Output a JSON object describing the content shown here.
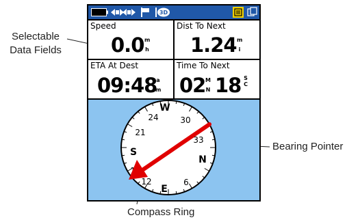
{
  "callouts": {
    "data_fields_line1": "Selectable",
    "data_fields_line2": "Data Fields",
    "bearing_pointer": "Bearing Pointer",
    "compass_ring": "Compass Ring"
  },
  "status_bar": {
    "icons": [
      "battery-icon",
      "signal-icon",
      "flag-icon",
      "3d-fix-icon",
      "menu-icon",
      "page-icon"
    ],
    "fix_badge": "3D",
    "colors": {
      "bar": "#2058a8",
      "menu_button": "#f0d000"
    }
  },
  "fields": {
    "speed": {
      "label": "Speed",
      "value": "0.0",
      "unit_top": "m",
      "unit_bottom": "h"
    },
    "dist_to_next": {
      "label": "Dist To Next",
      "value": "1.24",
      "unit_top": "m",
      "unit_bottom": "i"
    },
    "eta_at_dest": {
      "label": "ETA At Dest",
      "value": "09:48",
      "unit_top": "a",
      "unit_bottom": "m"
    },
    "time_to_next": {
      "label": "Time To Next",
      "value_min": "02",
      "unit_min_top": "M",
      "unit_min_bottom": "N",
      "value_sec": "18",
      "unit_sec_top": "S",
      "unit_sec_bottom": "C"
    }
  },
  "compass": {
    "labels": {
      "N": "N",
      "E": "E",
      "S": "S",
      "W": "W"
    },
    "ticks": [
      "33",
      "30",
      "24",
      "21",
      "15",
      "12",
      "6"
    ],
    "background": "#8cc4f0",
    "pointer_color": "#e00000"
  }
}
